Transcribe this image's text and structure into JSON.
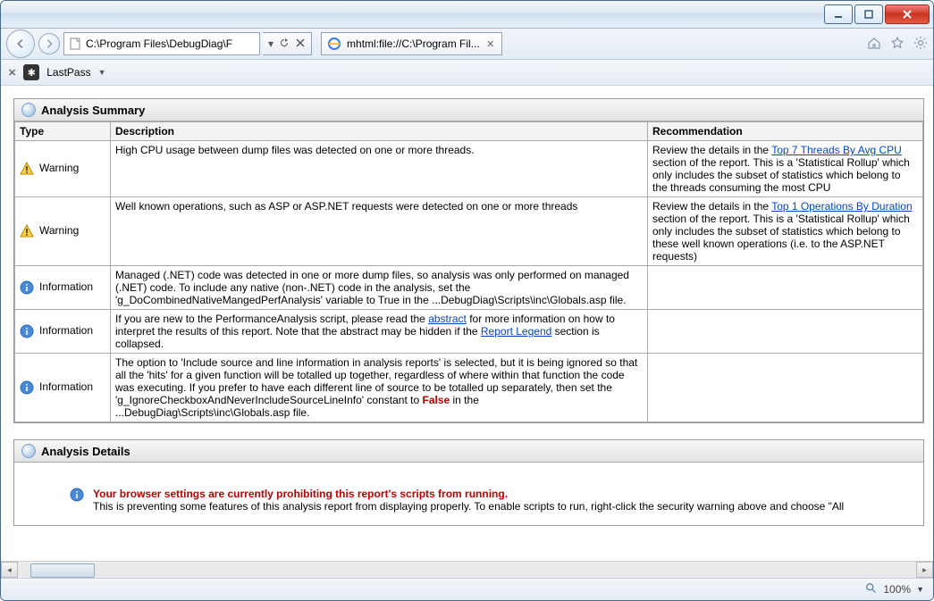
{
  "window": {
    "address": "C:\\Program Files\\DebugDiag\\F",
    "tab_title": "mhtml:file://C:\\Program Fil...",
    "toolbar_app": "LastPass",
    "zoom": "100%"
  },
  "summary": {
    "title": "Analysis Summary",
    "columns": {
      "type": "Type",
      "description": "Description",
      "recommendation": "Recommendation"
    },
    "rows": [
      {
        "icon": "warning",
        "type": "Warning",
        "description": "High CPU usage between dump files was detected on one or more threads.",
        "rec_pre": "Review the details in the ",
        "rec_link": "Top 7 Threads By Avg CPU",
        "rec_post": " section of the report. This is a 'Statistical Rollup' which only includes the subset of statistics which belong to the threads consuming the most CPU"
      },
      {
        "icon": "warning",
        "type": "Warning",
        "description": "Well known operations, such as ASP or ASP.NET requests were detected on one or more threads",
        "rec_pre": "Review the details in the ",
        "rec_link": "Top 1 Operations By Duration",
        "rec_post": " section of the report. This is a 'Statistical Rollup' which only includes the subset of statistics which belong to these well known operations (i.e. to the ASP.NET requests)"
      },
      {
        "icon": "info",
        "type": "Information",
        "description": "Managed (.NET) code was detected in one or more dump files, so analysis was only performed on managed (.NET) code. To include any native (non-.NET) code in the analysis, set the 'g_DoCombinedNativeMangedPerfAnalysis' variable to True in the ...DebugDiag\\Scripts\\inc\\Globals.asp file.",
        "rec_pre": "",
        "rec_link": "",
        "rec_post": ""
      },
      {
        "icon": "info",
        "type": "Information",
        "desc_pre": "If you are new to the PerformanceAnalysis script, please read the ",
        "desc_link1": "abstract",
        "desc_mid": " for more information on how to interpret the results of this report.   Note that the abstract may be hidden if the ",
        "desc_link2": "Report Legend",
        "desc_post": " section is collapsed.",
        "rec_pre": "",
        "rec_link": "",
        "rec_post": ""
      },
      {
        "icon": "info",
        "type": "Information",
        "desc_pre": "The option to 'Include source and line information in analysis reports' is selected, but it is being ignored so that all the 'hits' for a given function will be totalled up together, regardless of where within that function the code was executing. If you prefer to have each different line of source to be totalled up separately, then set the 'g_IgnoreCheckboxAndNeverIncludeSourceLineInfo' constant to ",
        "desc_false": "False",
        "desc_post": " in the ...DebugDiag\\Scripts\\inc\\Globals.asp file.",
        "rec_pre": "",
        "rec_link": "",
        "rec_post": ""
      }
    ]
  },
  "details": {
    "title": "Analysis Details",
    "script_warning_bold": "Your browser settings are currently prohibiting this report's scripts from running.",
    "script_warning_rest": "This is preventing some features of this analysis report from displaying properly. To enable scripts to run, right-click the security warning above and choose \"All"
  }
}
